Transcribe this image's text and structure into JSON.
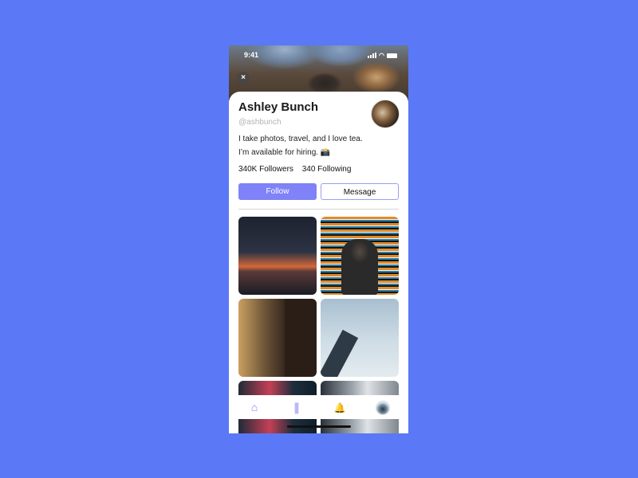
{
  "status_bar": {
    "time": "9:41"
  },
  "profile": {
    "name": "Ashley Bunch",
    "handle": "@ashbunch",
    "bio": "I take photos, travel, and I love tea. I’m available for hiring. 📸",
    "followers": "340K Followers",
    "following": "340 Following"
  },
  "actions": {
    "follow_label": "Follow",
    "message_label": "Message"
  },
  "icons": {
    "close": "×",
    "home": "⌂",
    "bookmark": "❚",
    "bell": "🔔"
  },
  "colors": {
    "background": "#5b78f6",
    "accent": "#7f83f7",
    "accent_light": "#b7baf8"
  },
  "tabbar": {
    "items": [
      "home",
      "bookmarks",
      "notifications",
      "profile"
    ]
  }
}
